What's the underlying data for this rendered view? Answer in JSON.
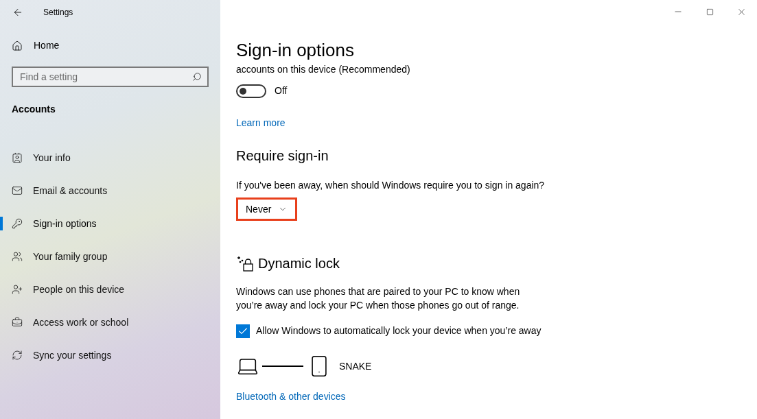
{
  "window": {
    "title": "Settings"
  },
  "sidebar": {
    "home": "Home",
    "search": {
      "placeholder": "Find a setting"
    },
    "section": "Accounts",
    "items": [
      {
        "label": "Your info",
        "selected": false
      },
      {
        "label": "Email & accounts",
        "selected": false
      },
      {
        "label": "Sign-in options",
        "selected": true
      },
      {
        "label": "Your family group",
        "selected": false
      },
      {
        "label": "People on this device",
        "selected": false
      },
      {
        "label": "Access work or school",
        "selected": false
      },
      {
        "label": "Sync your settings",
        "selected": false
      }
    ]
  },
  "page": {
    "title": "Sign-in options",
    "toggle_setting": {
      "text": "accounts on this device (Recommended)",
      "on": false,
      "state_label": "Off"
    },
    "learn_more": "Learn more",
    "require_signin": {
      "heading": "Require sign-in",
      "description": "If you've been away, when should Windows require you to sign in again?",
      "dropdown": {
        "value": "Never",
        "highlighted": true
      }
    },
    "dynamic_lock": {
      "heading": "Dynamic lock",
      "description": "Windows can use phones that are paired to your PC to know when you’re away and lock your PC when those phones go out of range.",
      "checkbox": {
        "label": "Allow Windows to automatically lock your device when you’re away",
        "checked": true
      },
      "paired_device": "SNAKE",
      "link": "Bluetooth & other devices"
    }
  }
}
